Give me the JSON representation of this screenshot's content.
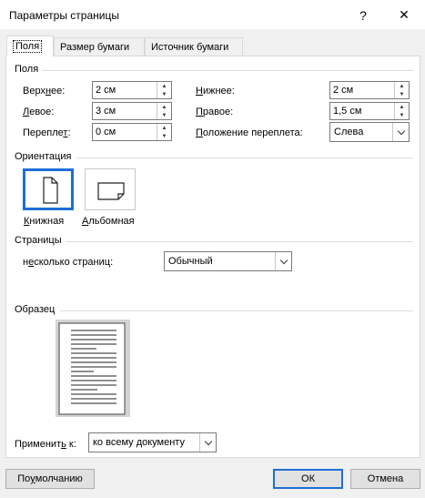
{
  "window": {
    "title": "Параметры страницы",
    "help_label": "?",
    "close_label": "✕"
  },
  "tabs": [
    {
      "label": "Поля"
    },
    {
      "label": "Размер бумаги"
    },
    {
      "label": "Источник бумаги"
    }
  ],
  "margins": {
    "section_title": "Поля",
    "top": {
      "label_pre": "Верх",
      "label_u": "н",
      "label_post": "ее:",
      "value": "2 см"
    },
    "left": {
      "label_pre": "",
      "label_u": "Л",
      "label_post": "евое:",
      "value": "3 см"
    },
    "gutter": {
      "label_pre": "Перепле",
      "label_u": "т",
      "label_post": ":",
      "value": "0 см"
    },
    "bottom": {
      "label_pre": "",
      "label_u": "Н",
      "label_post": "ижнее:",
      "value": "2 см"
    },
    "right": {
      "label_pre": "",
      "label_u": "П",
      "label_post": "равое:",
      "value": "1,5 см"
    },
    "gutter_pos": {
      "label_pre": "",
      "label_u": "П",
      "label_post": "оложение переплета:",
      "value": "Слева"
    }
  },
  "orientation": {
    "section_title": "Ориентация",
    "portrait": {
      "label_pre": "",
      "label_u": "К",
      "label_post": "нижная"
    },
    "landscape": {
      "label_pre": "",
      "label_u": "А",
      "label_post": "льбомная"
    }
  },
  "pages": {
    "section_title": "Страницы",
    "multi_label_pre": "н",
    "multi_label_u": "е",
    "multi_label_post": "сколько страниц:",
    "multi_value": "Обычный"
  },
  "preview": {
    "section_title": "Образец"
  },
  "apply": {
    "label_pre": "Применит",
    "label_u": "ь",
    "label_post": " к:",
    "value": "ко всему документу"
  },
  "buttons": {
    "default_pre": "По ",
    "default_u": "у",
    "default_post": "молчанию",
    "ok": "ОК",
    "cancel": "Отмена"
  }
}
